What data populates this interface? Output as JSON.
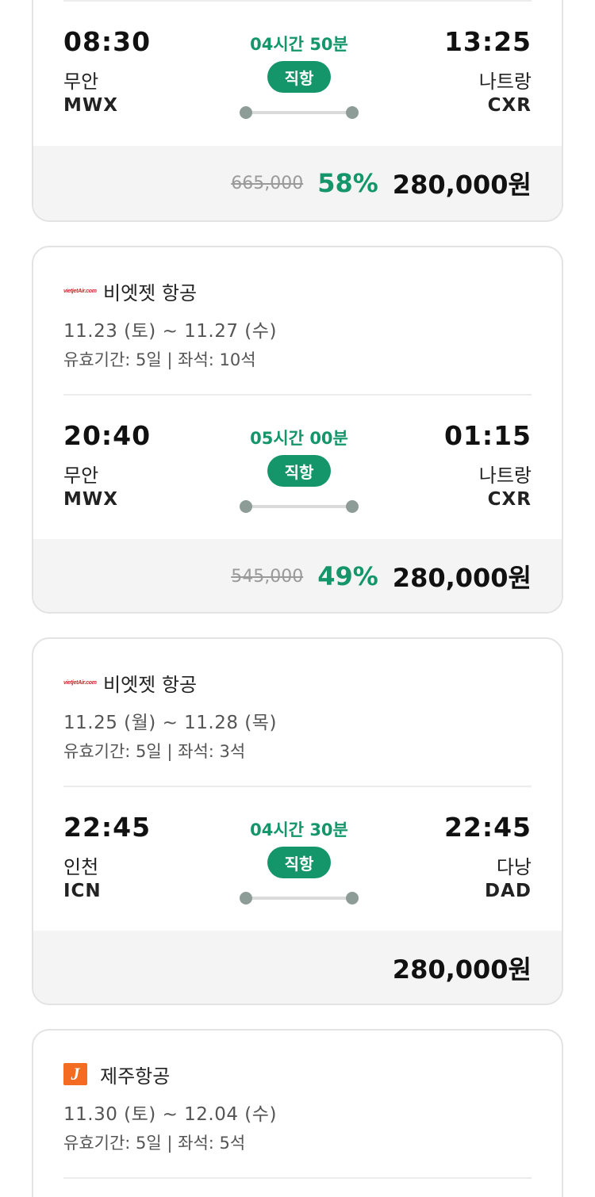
{
  "flights": [
    {
      "airline": "",
      "dates": "",
      "validity": "",
      "depart_time": "08:30",
      "depart_city": "무안",
      "depart_code": "MWX",
      "arrive_time": "13:25",
      "arrive_city": "나트랑",
      "arrive_code": "CXR",
      "duration": "04시간 50분",
      "direct": "직항",
      "original_price": "665,000",
      "discount": "58%",
      "price": "280,000원"
    },
    {
      "airline": "비엣젯 항공",
      "airline_logo_text": "vietjetAir.com",
      "dates": "11.23 (토) ~ 11.27 (수)",
      "validity": "유효기간: 5일 | 좌석: 10석",
      "depart_time": "20:40",
      "depart_city": "무안",
      "depart_code": "MWX",
      "arrive_time": "01:15",
      "arrive_city": "나트랑",
      "arrive_code": "CXR",
      "duration": "05시간 00분",
      "direct": "직항",
      "original_price": "545,000",
      "discount": "49%",
      "price": "280,000원"
    },
    {
      "airline": "비엣젯 항공",
      "airline_logo_text": "vietjetAir.com",
      "dates": "11.25 (월) ~ 11.28 (목)",
      "validity": "유효기간: 5일 | 좌석: 3석",
      "depart_time": "22:45",
      "depart_city": "인천",
      "depart_code": "ICN",
      "arrive_time": "22:45",
      "arrive_city": "다낭",
      "arrive_code": "DAD",
      "duration": "04시간 30분",
      "direct": "직항",
      "original_price": "",
      "discount": "",
      "price": "280,000원"
    },
    {
      "airline": "제주항공",
      "airline_logo_text": "J",
      "dates": "11.30 (토) ~ 12.04 (수)",
      "validity": "유효기간: 5일 | 좌석: 5석"
    }
  ],
  "colors": {
    "accent": "#14966a",
    "route_dot": "#8d9c96",
    "price_bar_bg": "#f4f4f4",
    "vietjet_red": "#d2232a",
    "jeju_orange": "#f36c21"
  }
}
